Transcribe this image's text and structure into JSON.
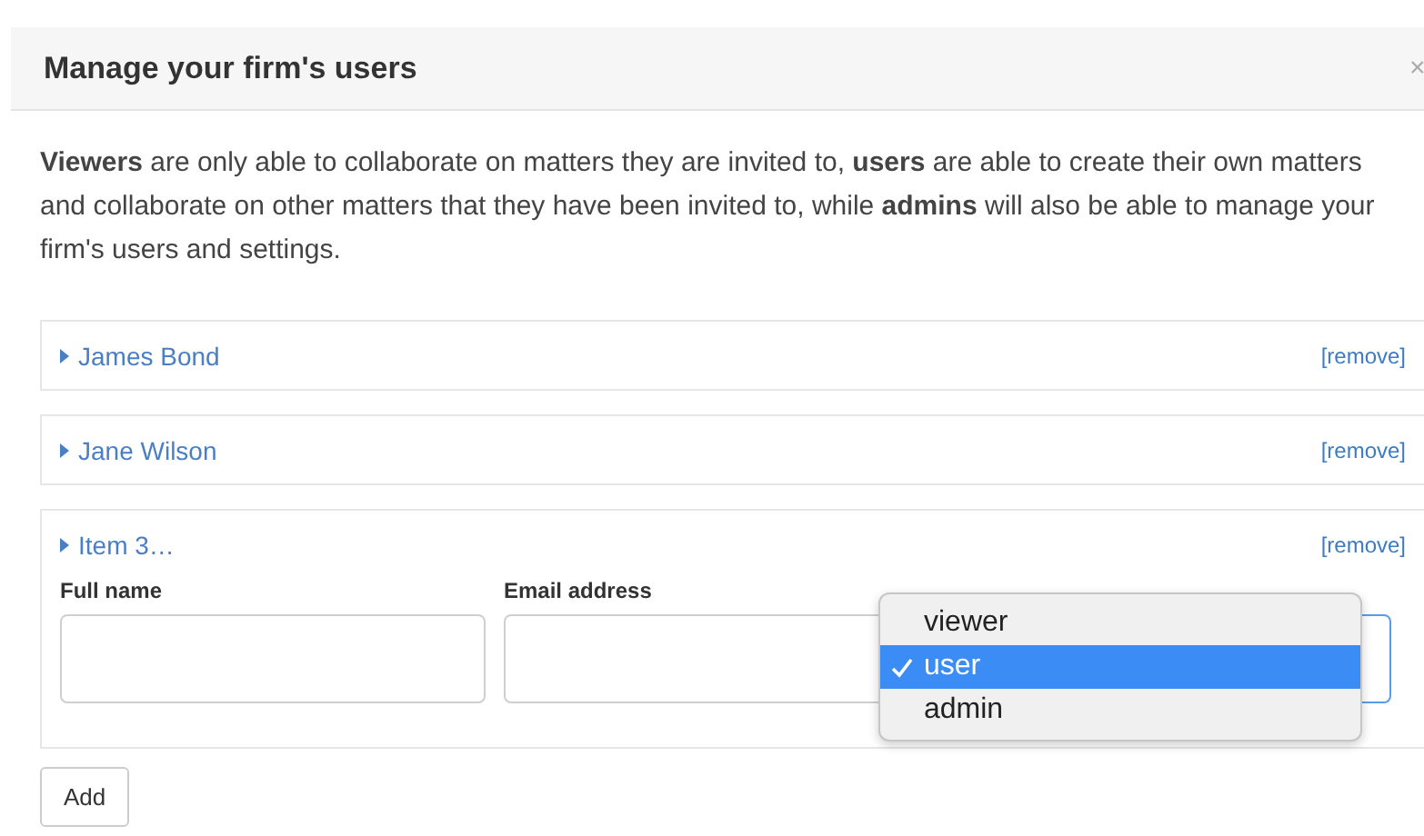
{
  "dialog": {
    "title": "Manage your firm's users",
    "close": "×"
  },
  "intro": "**Viewers** are only able to collaborate on matters they are invited to, **users** are able to create their own matters and collaborate on other matters that they have been invited to, while **admins** will also be able to manage your firm's users and settings.",
  "users": [
    {
      "name": "James Bond",
      "expanded": false,
      "remove": "[remove]"
    },
    {
      "name": "Jane Wilson",
      "expanded": false,
      "remove": "[remove]"
    },
    {
      "name": "Item 3…",
      "expanded": true,
      "remove": "[remove]"
    }
  ],
  "form": {
    "fields": [
      {
        "kind": "text",
        "label": "Full name"
      },
      {
        "kind": "text",
        "label": "Email address"
      },
      {
        "kind": "select"
      }
    ]
  },
  "access_menu": {
    "options": [
      {
        "label": "viewer",
        "selected": false
      },
      {
        "label": "user",
        "selected": true
      },
      {
        "label": "admin",
        "selected": false
      }
    ]
  },
  "add_button": "Add"
}
